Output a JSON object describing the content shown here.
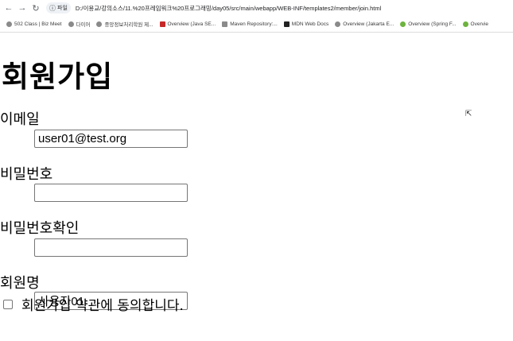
{
  "browser": {
    "info_chip": "파일",
    "url": "D:/이용교/강의소스/11.%20프레임워크%20프로그래밍/day05/src/main/webapp/WEB-INF/templates2/member/join.html",
    "bookmarks": [
      {
        "label": "502 Class | Biz Meet",
        "icon": "globe-icon"
      },
      {
        "label": "다이어",
        "icon": "globe-icon"
      },
      {
        "label": "중앙정보처리학원 제...",
        "icon": "globe-icon"
      },
      {
        "label": "Overview (Java SE...",
        "icon": "oracle-icon"
      },
      {
        "label": "Maven Repository:...",
        "icon": "maven-icon"
      },
      {
        "label": "MDN Web Docs",
        "icon": "mdn-icon"
      },
      {
        "label": "Overview (Jakarta E...",
        "icon": "globe-icon"
      },
      {
        "label": "Overview (Spring F...",
        "icon": "spring-icon"
      },
      {
        "label": "Overvie",
        "icon": "spring-icon"
      }
    ]
  },
  "page": {
    "title": "회원가입",
    "email": {
      "label": "이메일",
      "value": "user01@test.org"
    },
    "password": {
      "label": "비밀번호",
      "value": ""
    },
    "password_confirm": {
      "label": "비밀번호확인",
      "value": ""
    },
    "name": {
      "label": "회원명",
      "value": "사용자01"
    },
    "agree": {
      "label": "회원가입 약관에 동의합니다.",
      "checked": false
    }
  }
}
